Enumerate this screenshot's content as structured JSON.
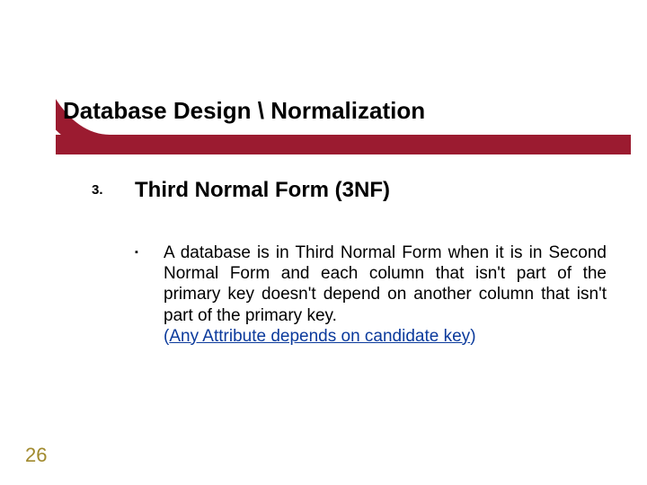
{
  "title": "Database Design \\ Normalization",
  "heading": {
    "number": "3.",
    "text": "Third Normal Form (3NF)"
  },
  "body": {
    "bullet": "▪",
    "paragraph": "A database is in Third Normal Form when it is in Second Normal Form and each column that isn't part of the primary key doesn't depend on another column that isn't part of the primary key.",
    "note_open": "(",
    "note_link": "Any Attribute depends on candidate key",
    "note_close": ")"
  },
  "page_number": "26",
  "colors": {
    "accent": "#9b1b30",
    "footer": "#a18a2e",
    "link": "#0b3a9c"
  }
}
